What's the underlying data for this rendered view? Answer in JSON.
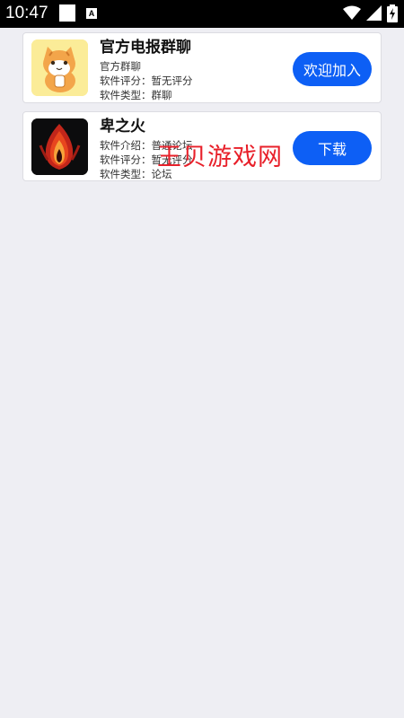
{
  "status_bar": {
    "time": "10:47",
    "notification_icon_letter": "A"
  },
  "apps": [
    {
      "name": "官方电报群聊",
      "line1": "官方群聊",
      "line2": "软件评分：暂无评分",
      "line3": "软件类型：群聊",
      "button_label": "欢迎加入",
      "icon": "orange-cat-icon"
    },
    {
      "name": "卑之火",
      "line1": "软件介绍：普通论坛",
      "line2": "软件评分：暂无评分",
      "line3": "软件类型：论坛",
      "button_label": "下载",
      "icon": "red-flame-icon"
    }
  ],
  "watermark": "王贝游戏网",
  "colors": {
    "accent_button": "#0d5ff5",
    "background": "#eeeef3",
    "watermark": "#e8202a"
  }
}
